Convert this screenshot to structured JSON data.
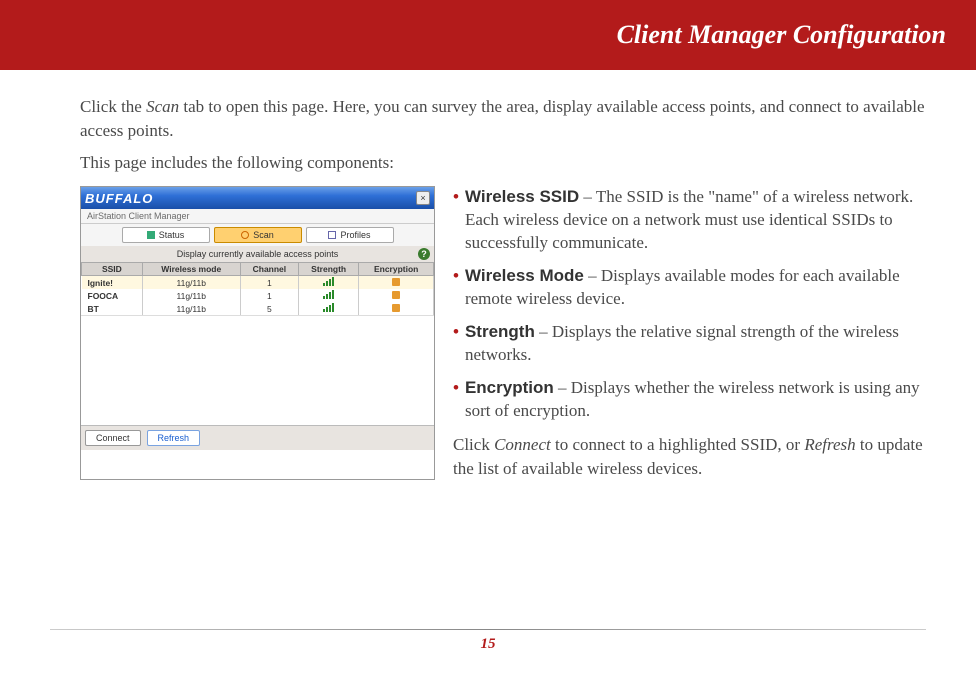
{
  "header": {
    "title": "Client Manager Configuration"
  },
  "intro": {
    "p1a": "Click the ",
    "p1em": "Scan",
    "p1b": " tab to open this page. Here, you can survey the area, display available access points, and connect to available access points.",
    "p2": "This page includes the following components:"
  },
  "screenshot": {
    "brand": "BUFFALO",
    "product": "AirStation Client Manager",
    "close": "×",
    "tabs": {
      "status": "Status",
      "scan": "Scan",
      "profiles": "Profiles"
    },
    "banner": "Display currently available access points",
    "help": "?",
    "columns": {
      "ssid": "SSID",
      "mode": "Wireless mode",
      "channel": "Channel",
      "strength": "Strength",
      "encryption": "Encryption"
    },
    "rows": [
      {
        "ssid": "Ignite!",
        "mode": "11g/11b",
        "channel": "1"
      },
      {
        "ssid": "FOOCA",
        "mode": "11g/11b",
        "channel": "1"
      },
      {
        "ssid": "BT",
        "mode": "11g/11b",
        "channel": "5"
      }
    ],
    "buttons": {
      "connect": "Connect",
      "refresh": "Refresh"
    }
  },
  "bullets": [
    {
      "term": "Wireless SSID",
      "desc": " – The SSID is the \"name\" of a wireless network. Each wireless device on a network must use identical SSIDs to successfully communicate."
    },
    {
      "term": "Wireless Mode",
      "desc": " – Displays available modes for each available remote wireless device."
    },
    {
      "term": "Strength",
      "desc": " – Displays the relative signal strength of the wireless networks."
    },
    {
      "term": "Encryption",
      "desc": " – Displays whether the wireless network is using any sort of encryption."
    }
  ],
  "closing": {
    "a": "Click ",
    "em1": "Connect",
    "b": " to connect to a highlighted SSID, or ",
    "em2": "Refresh",
    "c": " to update the list of available wireless devices."
  },
  "page_number": "15"
}
